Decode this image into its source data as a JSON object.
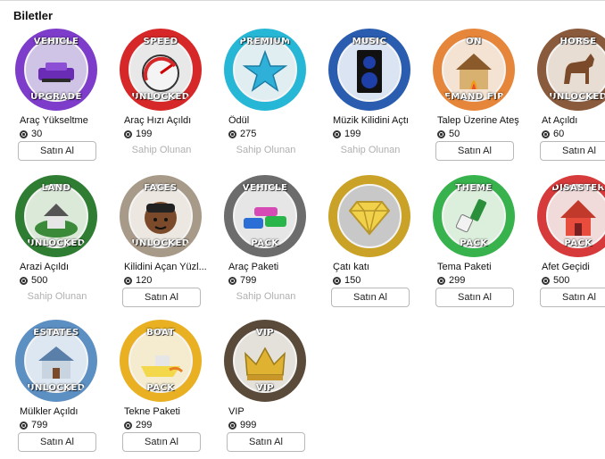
{
  "section": {
    "title": "Biletler"
  },
  "passes": [
    {
      "name": "Araç Yükseltme",
      "price": "30",
      "owned": false,
      "band_top": "VEHICLE",
      "band_bottom": "UPGRADE",
      "ring": "#7d3cc9",
      "inner": "#cfc4e6",
      "icon": "car-icon"
    },
    {
      "name": "Araç Hızı Açıldı",
      "price": "199",
      "owned": true,
      "band_top": "SPEED",
      "band_bottom": "UNLOCKED",
      "ring": "#d62828",
      "inner": "#e8e8e8",
      "icon": "speedometer-icon"
    },
    {
      "name": "Ödül",
      "price": "275",
      "owned": true,
      "band_top": "PREMIUM",
      "band_bottom": "",
      "ring": "#27b7d6",
      "inner": "#e0eef2",
      "icon": "star-icon"
    },
    {
      "name": "Müzik Kilidini Açtı",
      "price": "199",
      "owned": true,
      "band_top": "MUSIC",
      "band_bottom": "",
      "ring": "#2a5db0",
      "inner": "#dbe4f2",
      "icon": "speaker-icon"
    },
    {
      "name": "Talep Üzerine Ateş",
      "price": "50",
      "owned": false,
      "band_top": "ON",
      "band_bottom": "DEMAND FIRE",
      "ring": "#e6863a",
      "inner": "#f4e3d2",
      "icon": "burning-house-icon"
    },
    {
      "name": "At Açıldı",
      "price": "60",
      "owned": false,
      "band_top": "HORSE",
      "band_bottom": "UNLOCKED",
      "ring": "#8a5a3c",
      "inner": "#e8ddd3",
      "icon": "horse-icon"
    },
    {
      "name": "Arazi Açıldı",
      "price": "500",
      "owned": true,
      "band_top": "LAND",
      "band_bottom": "UNLOCKED",
      "ring": "#2f7d32",
      "inner": "#dbe9d9",
      "icon": "land-house-icon"
    },
    {
      "name": "Kilidini Açan Yüzl...",
      "price": "120",
      "owned": false,
      "band_top": "FACES",
      "band_bottom": "UNLOCKED",
      "ring": "#a89a88",
      "inner": "#ece7e0",
      "icon": "avatar-face-icon"
    },
    {
      "name": "Araç Paketi",
      "price": "799",
      "owned": true,
      "band_top": "VEHICLE",
      "band_bottom": "PACK",
      "ring": "#6c6c6c",
      "inner": "#e6e6e6",
      "icon": "cars-icon"
    },
    {
      "name": "Çatı katı",
      "price": "150",
      "owned": false,
      "band_top": "",
      "band_bottom": "",
      "ring": "#c9a227",
      "inner": "#c8c8c8",
      "icon": "diamond-icon"
    },
    {
      "name": "Tema Paketi",
      "price": "299",
      "owned": false,
      "band_top": "THEME",
      "band_bottom": "PACK",
      "ring": "#37b24d",
      "inner": "#dcefdc",
      "icon": "paintbrush-icon"
    },
    {
      "name": "Afet Geçidi",
      "price": "500",
      "owned": false,
      "band_top": "DISASTER",
      "band_bottom": "PACK",
      "ring": "#d63a3a",
      "inner": "#f0dada",
      "icon": "house-disaster-icon"
    },
    {
      "name": "Mülkler Açıldı",
      "price": "799",
      "owned": false,
      "band_top": "ESTATES",
      "band_bottom": "UNLOCKED",
      "ring": "#5c8fc2",
      "inner": "#dde7f1",
      "icon": "estate-house-icon"
    },
    {
      "name": "Tekne Paketi",
      "price": "299",
      "owned": false,
      "band_top": "BOAT",
      "band_bottom": "PACK",
      "ring": "#e8b022",
      "inner": "#f5ecd0",
      "icon": "boat-icon"
    },
    {
      "name": "VIP",
      "price": "999",
      "owned": false,
      "band_top": "VIP",
      "band_bottom": "VIP",
      "ring": "#5a4a3a",
      "inner": "#e4e0da",
      "icon": "crown-icon"
    }
  ],
  "labels": {
    "buy": "Satın Al",
    "owned": "Sahip Olunan"
  }
}
